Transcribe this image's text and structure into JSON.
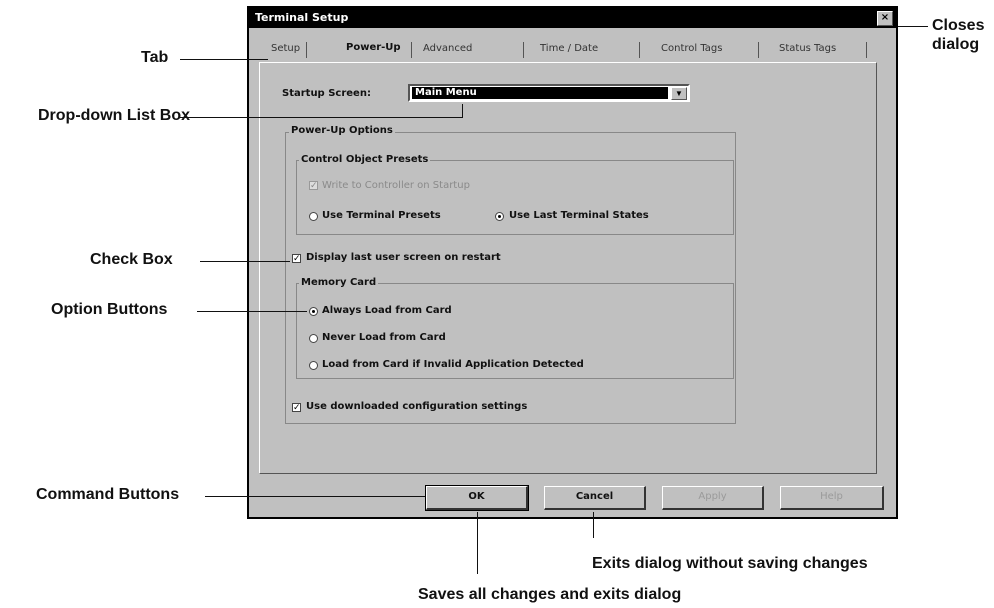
{
  "dialog": {
    "title": "Terminal Setup",
    "close_glyph": "×",
    "tabs": [
      {
        "label": "Setup"
      },
      {
        "label": "Power-Up"
      },
      {
        "label": "Advanced"
      },
      {
        "label": "Time / Date"
      },
      {
        "label": "Control Tags"
      },
      {
        "label": "Status Tags"
      }
    ],
    "startup_label": "Startup Screen:",
    "startup_value": "Main Menu",
    "power_up_options": "Power-Up Options",
    "control_object_presets": "Control Object Presets",
    "write_to_controller": "Write to Controller on Startup",
    "use_terminal_presets": "Use Terminal Presets",
    "use_last_terminal_states": "Use Last Terminal States",
    "display_last_screen": "Display last user screen on restart",
    "memory_card": "Memory Card",
    "always_load": "Always Load from Card",
    "never_load": "Never Load from Card",
    "load_if_invalid": "Load from Card if Invalid Application Detected",
    "use_downloaded": "Use downloaded configuration settings",
    "buttons": {
      "ok": "OK",
      "cancel": "Cancel",
      "apply": "Apply",
      "help": "Help"
    }
  },
  "annotations": {
    "tab": "Tab",
    "dropdown": "Drop-down List Box",
    "checkbox": "Check Box",
    "option_buttons": "Option Buttons",
    "command_buttons": "Command Buttons",
    "closes_dialog_1": "Closes",
    "closes_dialog_2": "dialog",
    "exits_without_saving": "Exits dialog without saving changes",
    "saves_all": "Saves all changes and exits dialog"
  }
}
